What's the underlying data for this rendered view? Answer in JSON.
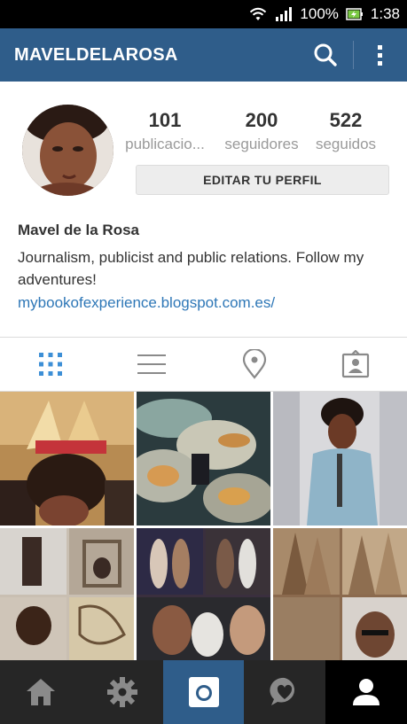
{
  "status_bar": {
    "battery": "100%",
    "time": "1:38"
  },
  "app_bar": {
    "title": "MAVELDELAROSA",
    "search_icon": "search-icon",
    "menu_icon": "more-vertical-icon"
  },
  "profile": {
    "stats": [
      {
        "count": "101",
        "label": "publicacio..."
      },
      {
        "count": "200",
        "label": "seguidores"
      },
      {
        "count": "522",
        "label": "seguidos"
      }
    ],
    "edit_button": "EDITAR TU PERFIL",
    "name": "Mavel de la Rosa",
    "bio": "Journalism, publicist and public relations. Follow my adventures!",
    "link": "mybookofexperience.blogspot.com.es/"
  },
  "view_tabs": [
    "grid-icon",
    "list-icon",
    "location-pin-icon",
    "tagged-photos-icon"
  ],
  "bottom_nav": [
    "home-icon",
    "explore-icon",
    "camera-icon",
    "activity-icon",
    "profile-icon"
  ],
  "colors": {
    "brand": "#2f5d8a",
    "link": "#2e77b7",
    "active_tab": "#3d8fd6",
    "nav_bg": "#262626"
  }
}
